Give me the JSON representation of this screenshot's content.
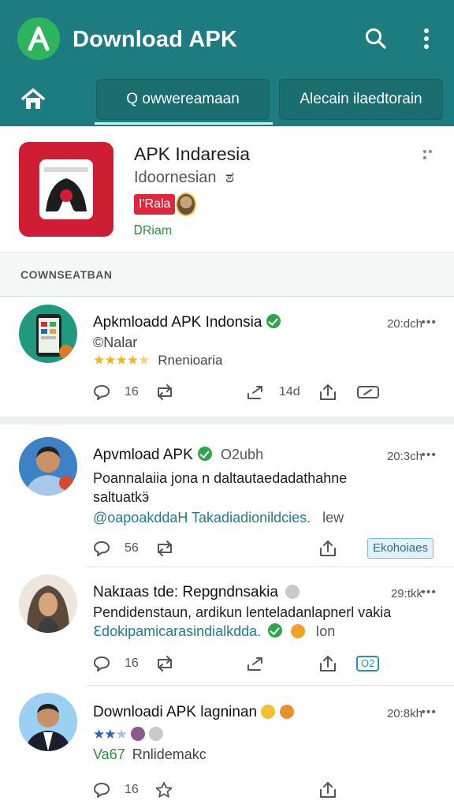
{
  "header": {
    "title": "Download APK",
    "tabs": [
      "Q owwereamaan",
      "Alecain ilaedtorain"
    ]
  },
  "app": {
    "name": "APK Indaresia",
    "subtitle": "Idoornesian",
    "subtitle_glyph": "ಶ",
    "badge": "I'Rala",
    "meta": "ᎠRiam"
  },
  "section_title": "COWNSEATBAN",
  "posts": [
    {
      "author": "Apkmloadd APK Indonsia",
      "time": "20:dch",
      "line1": "©Nalar",
      "rating_label": "Rnenioaria",
      "actions": {
        "reply": "16",
        "share": "14d"
      }
    },
    {
      "author": "Apvmload APK",
      "handle": "O2ubh",
      "time": "20:3ch",
      "line1": "Poannalaiia jona n daltautaedadathahne",
      "line2": "saltuatkӭ",
      "link": "@oapoakddaH Takadiadionildcies.",
      "link_tail": "lew",
      "actions": {
        "reply": "56",
        "button": "Ekohoiaes"
      }
    },
    {
      "author": "Nakɪaas tde: Repgndnsakia",
      "time": "29:tkk",
      "line1": "Pendidenstaun, ardikun lenteladanlapnerl vakia",
      "link": "Ꜫdokipamicarasindialkdda.",
      "link_tail": "Ion",
      "actions": {
        "reply": "16",
        "badge": "O2"
      }
    },
    {
      "author": "Downloadi APK lagninan",
      "time": "20:8kh",
      "rating_label": "Rnlidemakc",
      "rating_prefix": "Va67",
      "actions": {
        "reply": "16"
      }
    }
  ],
  "colors": {
    "primary": "#1d7c80",
    "accent_green": "#2eb35f",
    "brand_red": "#cf1d34",
    "link": "#1d7d8c"
  }
}
